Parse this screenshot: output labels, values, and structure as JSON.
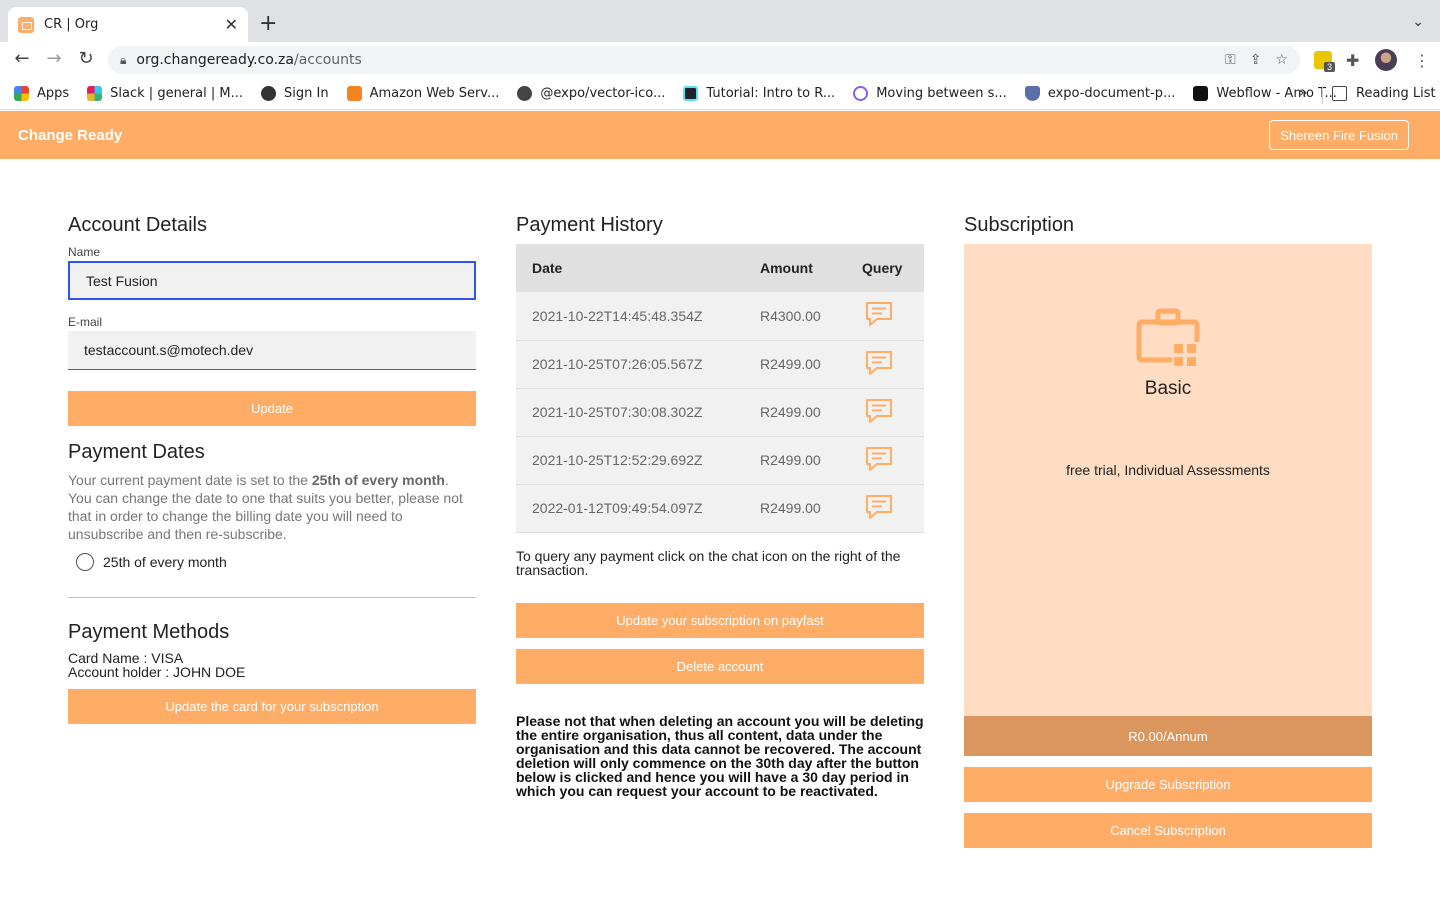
{
  "browser": {
    "tab_title": "CR | Org",
    "url_domain": "org.changeready.co.za",
    "url_path": "/accounts",
    "extension_badge": "3",
    "bookmarks": [
      {
        "label": "Apps",
        "icon": "apps-grid-icon",
        "color": "#4285f4"
      },
      {
        "label": "Slack | general | M...",
        "icon": "slack-icon",
        "color": "#4a154b"
      },
      {
        "label": "Sign In",
        "icon": "globe-icon",
        "color": "#333333"
      },
      {
        "label": "Amazon Web Serv...",
        "icon": "aws-cube-icon",
        "color": "#f7831f"
      },
      {
        "label": "@expo/vector-ico...",
        "icon": "expo-icon",
        "color": "#333333"
      },
      {
        "label": "Tutorial: Intro to R...",
        "icon": "react-icon",
        "color": "#20232a"
      },
      {
        "label": "Moving between s...",
        "icon": "circle-logo-icon",
        "color": "#8a5cf5"
      },
      {
        "label": "expo-document-p...",
        "icon": "shield-logo-icon",
        "color": "#5b6fa8"
      },
      {
        "label": "Webflow - Amo T...",
        "icon": "webflow-icon",
        "color": "#111111"
      }
    ],
    "more_label": "»",
    "reading_list": "Reading List"
  },
  "app": {
    "brand": "Change Ready",
    "user_button": "Shereen Fire Fusion",
    "accent": "#ffad66"
  },
  "account": {
    "heading": "Account Details",
    "name_label": "Name",
    "name_value": "Test Fusion",
    "email_label": "E-mail",
    "email_value": "testaccount.s@motech.dev",
    "update_button": "Update"
  },
  "payment_dates": {
    "heading": "Payment Dates",
    "text_before": "Your current payment date is set to the ",
    "text_bold": "25th of every month",
    "text_after": ". You can change the date to one that suits you better, please not that in order to change the billing date you will need to unsubscribe and then re-subscribe.",
    "radio_label": "25th of every month"
  },
  "payment_methods": {
    "heading": "Payment Methods",
    "card_name": "Card Name : VISA",
    "account_holder": "Account holder : JOHN DOE",
    "update_card_button": "Update the card for your subscription"
  },
  "payment_history": {
    "heading": "Payment History",
    "columns": [
      "Date",
      "Amount",
      "Query"
    ],
    "rows": [
      {
        "date": "2021-10-22T14:45:48.354Z",
        "amount": "R4300.00"
      },
      {
        "date": "2021-10-25T07:26:05.567Z",
        "amount": "R2499.00"
      },
      {
        "date": "2021-10-25T07:30:08.302Z",
        "amount": "R2499.00"
      },
      {
        "date": "2021-10-25T12:52:29.692Z",
        "amount": "R2499.00"
      },
      {
        "date": "2022-01-12T09:49:54.097Z",
        "amount": "R2499.00"
      }
    ],
    "note": "To query any payment click on the chat icon on the right of the transaction.",
    "update_sub_button": "Update your subscription on payfast",
    "delete_button": "Delete account",
    "warning": "Please not that when deleting an account you will be deleting the entire organisation, thus all content, data under the organisation and this data cannot be recovered. The account deletion will only commence on the 30th day after the button below is clicked and hence you will have a 30 day period in which you can request your account to be reactivated."
  },
  "subscription": {
    "heading": "Subscription",
    "plan": "Basic",
    "description": "free trial, Individual Assessments",
    "price": "R0.00/Annum",
    "upgrade_button": "Upgrade Subscription",
    "cancel_button": "Cancel Subscription"
  }
}
